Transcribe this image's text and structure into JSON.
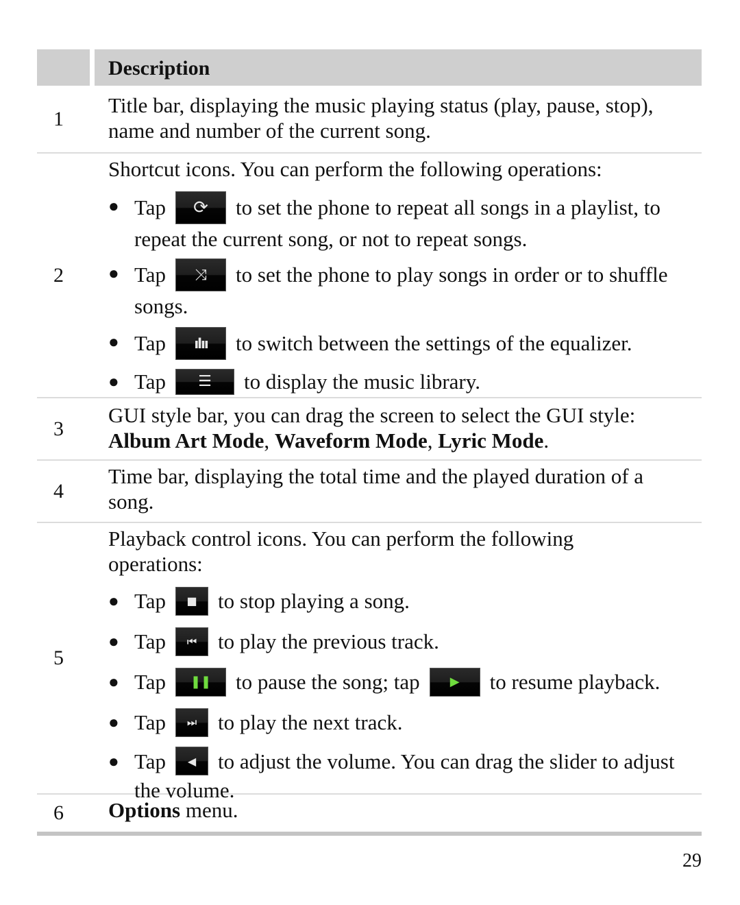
{
  "table": {
    "header": {
      "col1": "",
      "col2": "Description"
    },
    "rows": [
      {
        "num": "1",
        "text": "Title bar, displaying the music playing status (play, pause, stop), name and number of the current song."
      },
      {
        "num": "2",
        "intro": "Shortcut icons. You can perform the following operations:",
        "bullets": [
          {
            "tap": "Tap",
            "icon": "repeat-icon",
            "text": "to set the phone to repeat all songs in a playlist, to repeat the current song, or not to repeat songs."
          },
          {
            "tap": "Tap",
            "icon": "shuffle-icon",
            "text": "to set the phone to play songs in order or to shuffle songs."
          },
          {
            "tap": "Tap",
            "icon": "equalizer-icon",
            "text": "to switch between the settings of the equalizer."
          },
          {
            "tap": "Tap",
            "icon": "music-library-icon",
            "text": "to display the music library."
          }
        ]
      },
      {
        "num": "3",
        "text": "GUI style bar, you can drag the screen to select the GUI style:",
        "modes": [
          "Album Art Mode",
          "Waveform Mode",
          "Lyric Mode"
        ],
        "sep": ", ",
        "end": "."
      },
      {
        "num": "4",
        "text": "Time bar, displaying the total time and the played duration of a song."
      },
      {
        "num": "5",
        "intro": "Playback control icons. You can perform the following operations:",
        "bullets": [
          {
            "tap": "Tap",
            "icon": "stop-icon",
            "text": "to stop playing a song."
          },
          {
            "tap": "Tap",
            "icon": "previous-track-icon",
            "text": "to play the previous track."
          },
          {
            "tap": "Tap",
            "icon": "pause-icon",
            "text": "to pause the song; tap",
            "icon2": "play-icon",
            "text2": "to resume playback."
          },
          {
            "tap": "Tap",
            "icon": "next-track-icon",
            "text": "to play the next track."
          },
          {
            "tap": "Tap",
            "icon": "volume-icon",
            "text": "to adjust the volume. You can drag the slider to adjust the volume."
          }
        ]
      },
      {
        "num": "6",
        "bold": "Options",
        "text": " menu."
      }
    ]
  },
  "page_number": "29"
}
